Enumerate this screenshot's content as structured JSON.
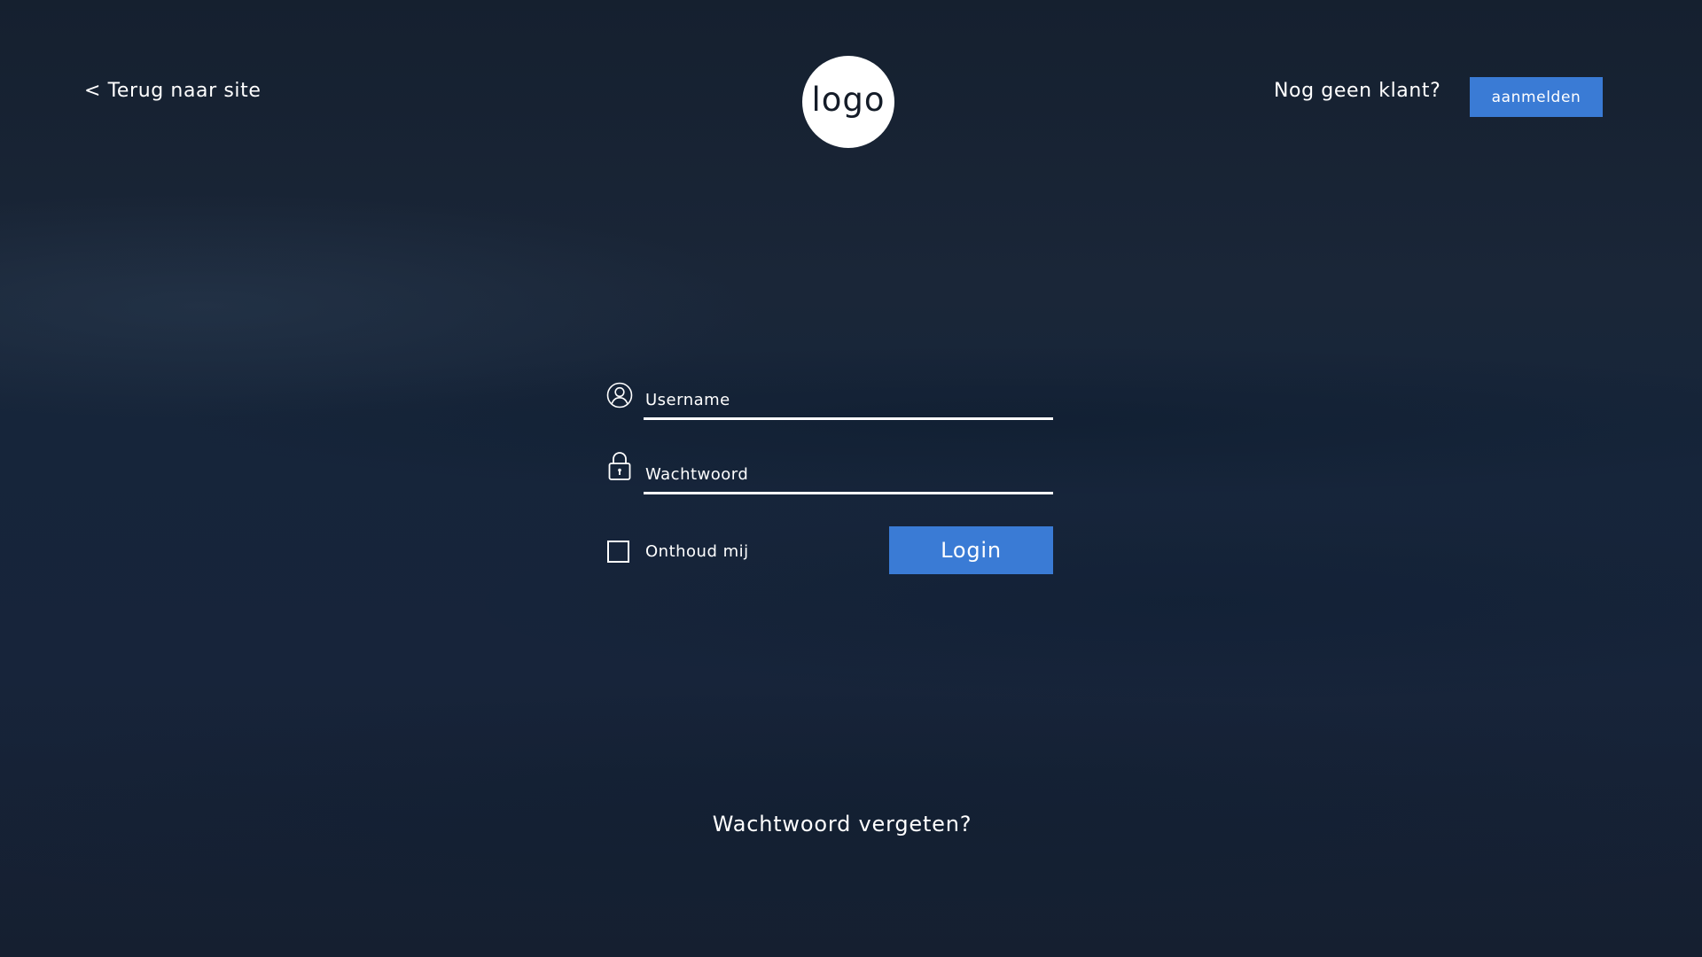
{
  "header": {
    "back_link": "< Terug naar site",
    "logo_text": "logo",
    "no_client_text": "Nog geen klant?",
    "signup_label": "aanmelden"
  },
  "form": {
    "username_placeholder": "Username",
    "password_placeholder": "Wachtwoord",
    "remember_label": "Onthoud mij",
    "remember_checked": false,
    "login_label": "Login",
    "forgot_password": "Wachtwoord vergeten?"
  },
  "icons": {
    "username": "user-circle-icon",
    "password": "lock-icon"
  },
  "colors": {
    "accent": "#3a7bd5",
    "background": "#17233a",
    "text": "#ffffff"
  }
}
